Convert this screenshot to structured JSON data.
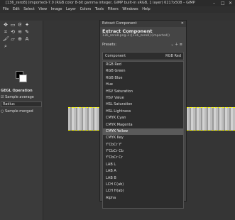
{
  "window": {
    "title": "[136_zero8] (imported)-7.0 (RGB color 8-bit gamma integer, GIMP built-in sRGB, 1 layer) 6217x508 – GIMP",
    "min": "–",
    "max": "□",
    "close": "✕"
  },
  "menubar": [
    "File",
    "Edit",
    "Select",
    "View",
    "Image",
    "Layer",
    "Colors",
    "Tools",
    "Filters",
    "Windows",
    "Help"
  ],
  "tool_options": {
    "title": "GEGL Operation",
    "sample_average": "Sample average",
    "radius_label": "Radius",
    "sample_merged": "Sample merged"
  },
  "dialog": {
    "title": "Extract Component",
    "heading": "Extract Component",
    "subtitle": "136_zero8.png-3 ([136_zero8] (imported))",
    "presets_label": "Presets:",
    "component_label": "Component",
    "component_value": "RGB Red",
    "items": [
      "RGB Red",
      "RGB Green",
      "RGB Blue",
      "Hue",
      "HSV Saturation",
      "HSV Value",
      "HSL Saturation",
      "HSL Lightness",
      "CMYK Cyan",
      "CMYK Magenta",
      "CMYK Yellow",
      "CMYK Key",
      "Y'CbCr Y'",
      "Y'CbCr Cb",
      "Y'CbCr Cr",
      "LAB L",
      "LAB A",
      "LAB B",
      "LCH C(ab)",
      "LCH H(ab)",
      "Alpha"
    ],
    "selected_index": 10
  }
}
